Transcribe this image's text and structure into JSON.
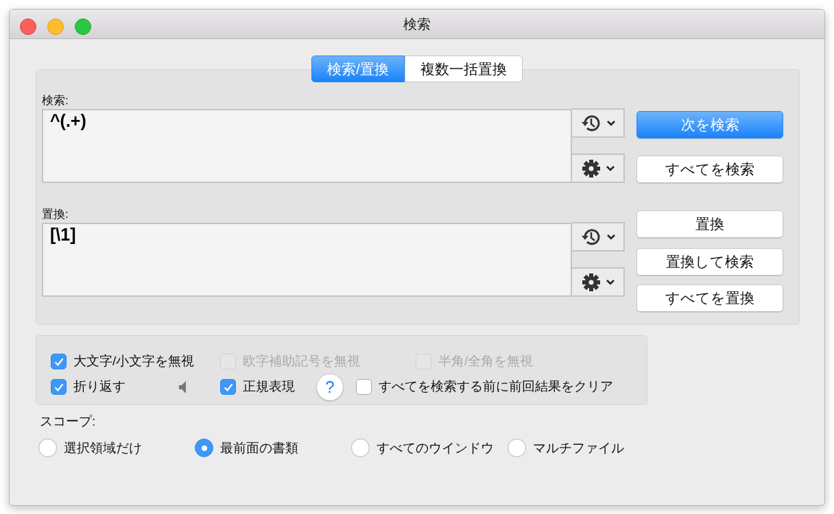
{
  "window": {
    "title": "検索"
  },
  "tabs": [
    {
      "label": "検索/置換",
      "selected": true
    },
    {
      "label": "複数一括置換",
      "selected": false
    }
  ],
  "search": {
    "label": "検索:",
    "value": "^(.+)",
    "buttons": [
      {
        "label": "次を検索",
        "default": true
      },
      {
        "label": "すべてを検索",
        "default": false
      }
    ]
  },
  "replace": {
    "label": "置換:",
    "value": "[\\1]",
    "buttons": [
      {
        "label": "置換",
        "default": false
      },
      {
        "label": "置換して検索",
        "default": false
      },
      {
        "label": "すべてを置換",
        "default": false
      }
    ]
  },
  "options": {
    "items": [
      {
        "kind": "checkbox",
        "label": "大文字/小文字を無視",
        "checked": true,
        "disabled": false
      },
      {
        "kind": "checkbox",
        "label": "欧字補助記号を無視",
        "checked": false,
        "disabled": true
      },
      {
        "kind": "checkbox",
        "label": "半角/全角を無視",
        "checked": false,
        "disabled": true
      },
      {
        "kind": "checkbox",
        "label": "折り返す",
        "checked": true,
        "disabled": false
      },
      {
        "kind": "speaker"
      },
      {
        "kind": "checkbox",
        "label": "正規表現",
        "checked": true,
        "disabled": false
      },
      {
        "kind": "help",
        "label": "?"
      },
      {
        "kind": "checkbox",
        "label": "すべてを検索する前に前回結果をクリア",
        "checked": false,
        "disabled": false
      }
    ]
  },
  "scope": {
    "label": "スコープ:",
    "options": [
      {
        "label": "選択領域だけ",
        "selected": false
      },
      {
        "label": "最前面の書類",
        "selected": true
      },
      {
        "label": "すべてのウインドウ",
        "selected": false
      },
      {
        "label": "マルチファイル",
        "selected": false
      }
    ]
  }
}
